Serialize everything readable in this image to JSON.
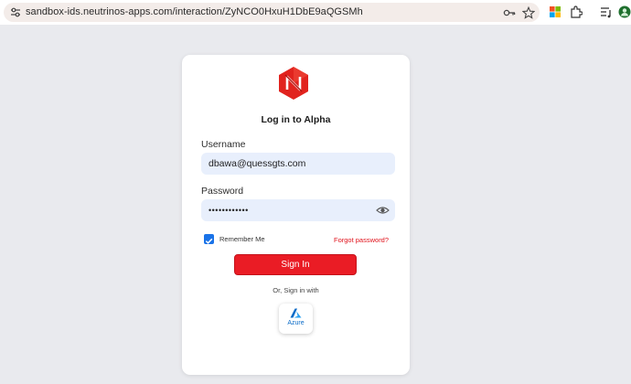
{
  "browser": {
    "url": "sandbox-ids.neutrinos-apps.com/interaction/ZyNCO0HxuH1DbE9aQGSMh",
    "icons": [
      "tune-icon",
      "key-icon",
      "star-icon",
      "microsoft-icon",
      "extensions-icon",
      "reading-list-icon",
      "profile-icon"
    ]
  },
  "login": {
    "logo_icon": "neutrinos-logo-icon",
    "title": "Log in to Alpha",
    "username_label": "Username",
    "username_value": "dbawa@quessgts.com",
    "password_label": "Password",
    "password_value": "••••••••••••",
    "remember_label": "Remember Me",
    "remember_checked": true,
    "forgot_label": "Forgot password?",
    "signin_label": "Sign In",
    "alt_signin_text": "Or, Sign in with",
    "azure_label": "Azure"
  },
  "colors": {
    "accent": "#ea1c25",
    "field_bg": "#e8effc",
    "page_bg": "#e9eaee",
    "checkbox": "#1a73e8"
  }
}
